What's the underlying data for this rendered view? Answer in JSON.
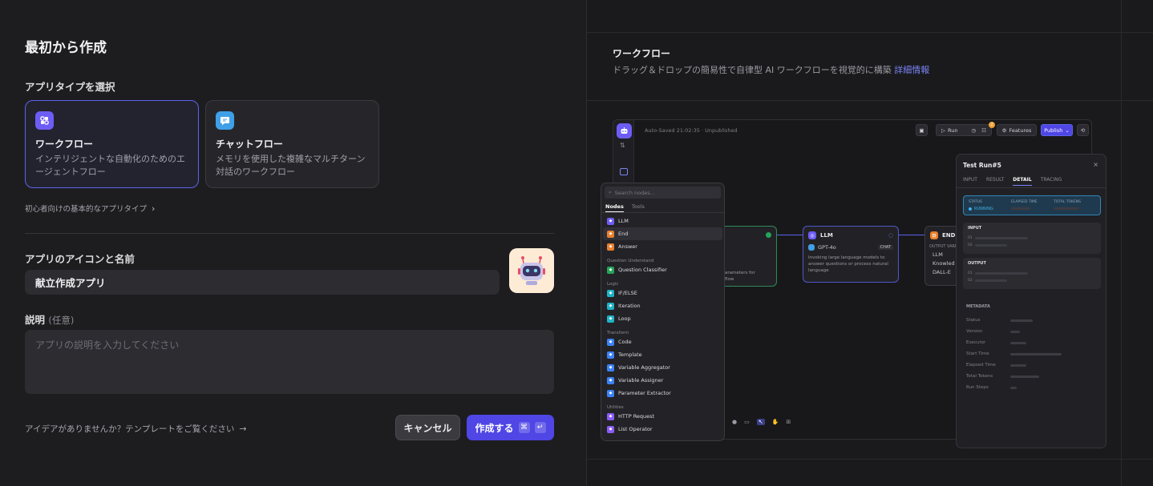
{
  "left": {
    "title": "最初から作成",
    "app_type_label": "アプリタイプを選択",
    "cards": [
      {
        "title": "ワークフロー",
        "desc": "インテリジェントな自動化のためのエージェントフロー",
        "icon": "workflow-icon",
        "color": "#6d5df5"
      },
      {
        "title": "チャットフロー",
        "desc": "メモリを使用した複雑なマルチターン対話のワークフロー",
        "icon": "chat-icon",
        "color": "#3fa0e8"
      }
    ],
    "basic_link": "初心者向けの基本的なアプリタイプ",
    "icon_name_label": "アプリのアイコンと名前",
    "name_value": "献立作成アプリ",
    "desc_label": "説明",
    "desc_optional": "(任意)",
    "desc_placeholder": "アプリの説明を入力してください",
    "idea_link": "アイデアがありませんか？テンプレートをご覧ください",
    "cancel_label": "キャンセル",
    "create_label": "作成する",
    "create_kbd": [
      "⌘",
      "↵"
    ],
    "accent": "#4f46e5"
  },
  "right": {
    "title": "ワークフロー",
    "desc": "ドラッグ＆ドロップの簡易性で自律型 AI ワークフローを視覚的に構築",
    "more_link": "詳細情報",
    "preview": {
      "autosave": "Auto-Saved 21:02:35 · Unpublished",
      "run_label": "Run",
      "features_label": "Features",
      "publish_label": "Publish",
      "badge": "2",
      "llm_node": {
        "title": "LLM",
        "model": "GPT-4o",
        "chat_badge": "CHAT",
        "desc": "Invoking large language models to answer questions or process natural language"
      },
      "end_node": {
        "title": "END",
        "output_label": "OUTPUT VARIA",
        "items": [
          "LLM",
          "Knowled",
          "DALL-E"
        ]
      },
      "start_node_desc": "arameters for\nflow",
      "picker": {
        "search_placeholder": "Search nodes...",
        "tabs": [
          "Nodes",
          "Tools"
        ],
        "items_top": [
          {
            "label": "LLM",
            "color": "#6d5df5"
          },
          {
            "label": "End",
            "color": "#e8802e"
          },
          {
            "label": "Answer",
            "color": "#e8802e"
          }
        ],
        "groups": [
          {
            "title": "Question Understand",
            "items": [
              {
                "label": "Question Classifier",
                "color": "#23a55a"
              }
            ]
          },
          {
            "title": "Logic",
            "items": [
              {
                "label": "IF/ELSE",
                "color": "#1fb2c6"
              },
              {
                "label": "Iteration",
                "color": "#1fb2c6"
              },
              {
                "label": "Loop",
                "color": "#1fb2c6"
              }
            ]
          },
          {
            "title": "Transform",
            "items": [
              {
                "label": "Code",
                "color": "#3b82f6"
              },
              {
                "label": "Template",
                "color": "#3b82f6"
              },
              {
                "label": "Variable Aggregator",
                "color": "#3b82f6"
              },
              {
                "label": "Variable Assigner",
                "color": "#3b82f6"
              },
              {
                "label": "Parameter Extractor",
                "color": "#3b82f6"
              }
            ]
          },
          {
            "title": "Utilities",
            "items": [
              {
                "label": "HTTP Request",
                "color": "#8b5cf6"
              },
              {
                "label": "List Operator",
                "color": "#8b5cf6"
              }
            ]
          }
        ]
      },
      "test_run": {
        "title": "Test Run#5",
        "tabs": [
          "INPUT",
          "RESULT",
          "DETAIL",
          "TRACING"
        ],
        "active_tab": "DETAIL",
        "status_headers": [
          "STATUS",
          "ELAPSED TIME",
          "TOTAL TOKENS"
        ],
        "status_value": "RUNNING",
        "input_label": "INPUT",
        "output_label": "OUTPUT",
        "row_nums": [
          "01",
          "02"
        ],
        "metadata_label": "METADATA",
        "metadata": [
          "Status",
          "Version",
          "Executor",
          "Start Time",
          "Elapsed Time",
          "Total Tokens",
          "Run Steps"
        ]
      }
    }
  }
}
